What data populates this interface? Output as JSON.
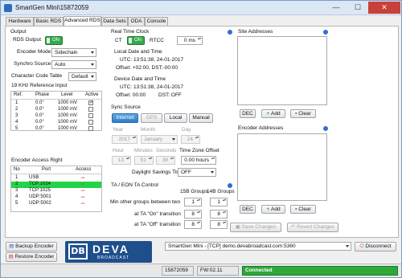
{
  "window": {
    "title": "SmartGen Mini\\15872059",
    "minimize": "—",
    "maximize": "☐",
    "close": "✕"
  },
  "tabs": [
    "Hardware",
    "Basic RDS",
    "Advanced RDS",
    "Data Sets",
    "ODA",
    "Console"
  ],
  "output": {
    "section": "Output",
    "rds_output_label": "RDS Output",
    "rds_output_toggle": "ON",
    "encoder_mode_label": "Encoder Mode",
    "encoder_mode_value": "Sidechain",
    "synchro_source_label": "Synchro Source",
    "synchro_source_value": "Auto",
    "char_table_label": "Character Code Table",
    "char_table_value": "Default",
    "ref_input_label": "19 KHz Reference Input",
    "ref_headers": [
      "Ref.",
      "Phase",
      "Level",
      "Active"
    ],
    "ref_rows": [
      {
        "ref": "1",
        "phase": "0.0°",
        "level": "1000 mV",
        "active": true
      },
      {
        "ref": "2",
        "phase": "0.0°",
        "level": "1000 mV",
        "active": false
      },
      {
        "ref": "3",
        "phase": "0.0°",
        "level": "1000 mV",
        "active": false
      },
      {
        "ref": "4",
        "phase": "0.0°",
        "level": "1000 mV",
        "active": false
      },
      {
        "ref": "5",
        "phase": "0.0°",
        "level": "1000 mV",
        "active": false
      }
    ]
  },
  "encoder_access": {
    "section": "Encoder Access Right",
    "headers": [
      "No",
      "Port",
      "Access"
    ],
    "rows": [
      {
        "no": "1",
        "port": "USB",
        "selected": false
      },
      {
        "no": "2",
        "port": "TCP:1024",
        "selected": true
      },
      {
        "no": "3",
        "port": "TCP:1025",
        "selected": false
      },
      {
        "no": "4",
        "port": "UDP:5001",
        "selected": false
      },
      {
        "no": "5",
        "port": "UDP:5002",
        "selected": false
      }
    ]
  },
  "rtc": {
    "section": "Real Time Clock",
    "ct_label": "CT",
    "ct_toggle": "ON",
    "rtcc_label": "RTCC",
    "rtcc_value": "0 ms",
    "local_title": "Local Date and Time",
    "local_utc": "UTC:  13:51:38, 24-01-2017",
    "local_offset": "Offset: +02:00, DST:-00:00",
    "device_title": "Device Date and Time",
    "device_utc": "UTC:  13:51:38, 24-01-2017",
    "device_offset": "Offset: 00:00",
    "device_dst": "DST:  OFF"
  },
  "sync": {
    "section": "Sync Source",
    "buttons": [
      "Internet",
      "GPS",
      "Local",
      "Manual"
    ],
    "year_label": "Year",
    "year_value": "2017",
    "month_label": "Month",
    "month_value": "January",
    "day_label": "Day",
    "day_value": "24",
    "hour_label": "Hour",
    "hour_value": "13",
    "minutes_label": "Minutes",
    "minutes_value": "51",
    "seconds_label": "Seconds",
    "seconds_value": "38",
    "tz_label": "Time Zone Offset",
    "tz_value": "0.00 hours",
    "dst_label": "Daylight Savings Time",
    "dst_value": "OFF"
  },
  "ta": {
    "section": "TA / EON TA Control",
    "col1": "15B Groups",
    "col2": "14B Groups",
    "rows": [
      {
        "label": "Min other groups between two",
        "v1": "1",
        "v2": "1"
      },
      {
        "label": "at TA \"On\" transition",
        "v1": "8",
        "v2": "8"
      },
      {
        "label": "at TA \"Off\" transition",
        "v1": "8",
        "v2": "8"
      }
    ]
  },
  "site": {
    "section": "Site Addresses",
    "dec": "DEC",
    "add": "Add",
    "clear": "Clear"
  },
  "encaddr": {
    "section": "Encoder Addresses",
    "dec": "DEC",
    "add": "Add",
    "clear": "Clear"
  },
  "save_changes": "Save Changes",
  "revert_changes": "Revert Changes",
  "backup": "Backup Encoder",
  "restore": "Restore Encoder",
  "logo": {
    "brand": "DEVA",
    "sub": "BROADCAST",
    "mark": "DB"
  },
  "connection": {
    "value": "SmartGen Mini - [TCP] demo.devabroadcast.com:5360",
    "disconnect": "Disconnect"
  },
  "statusbar": {
    "serial": "15872059",
    "fw": "FW:02.11",
    "state": "Connected"
  },
  "colors": {
    "accent": "#2f7dc8",
    "connected": "#2fa83a",
    "selected_row": "#22d447",
    "brand": "#1e4f8c"
  }
}
